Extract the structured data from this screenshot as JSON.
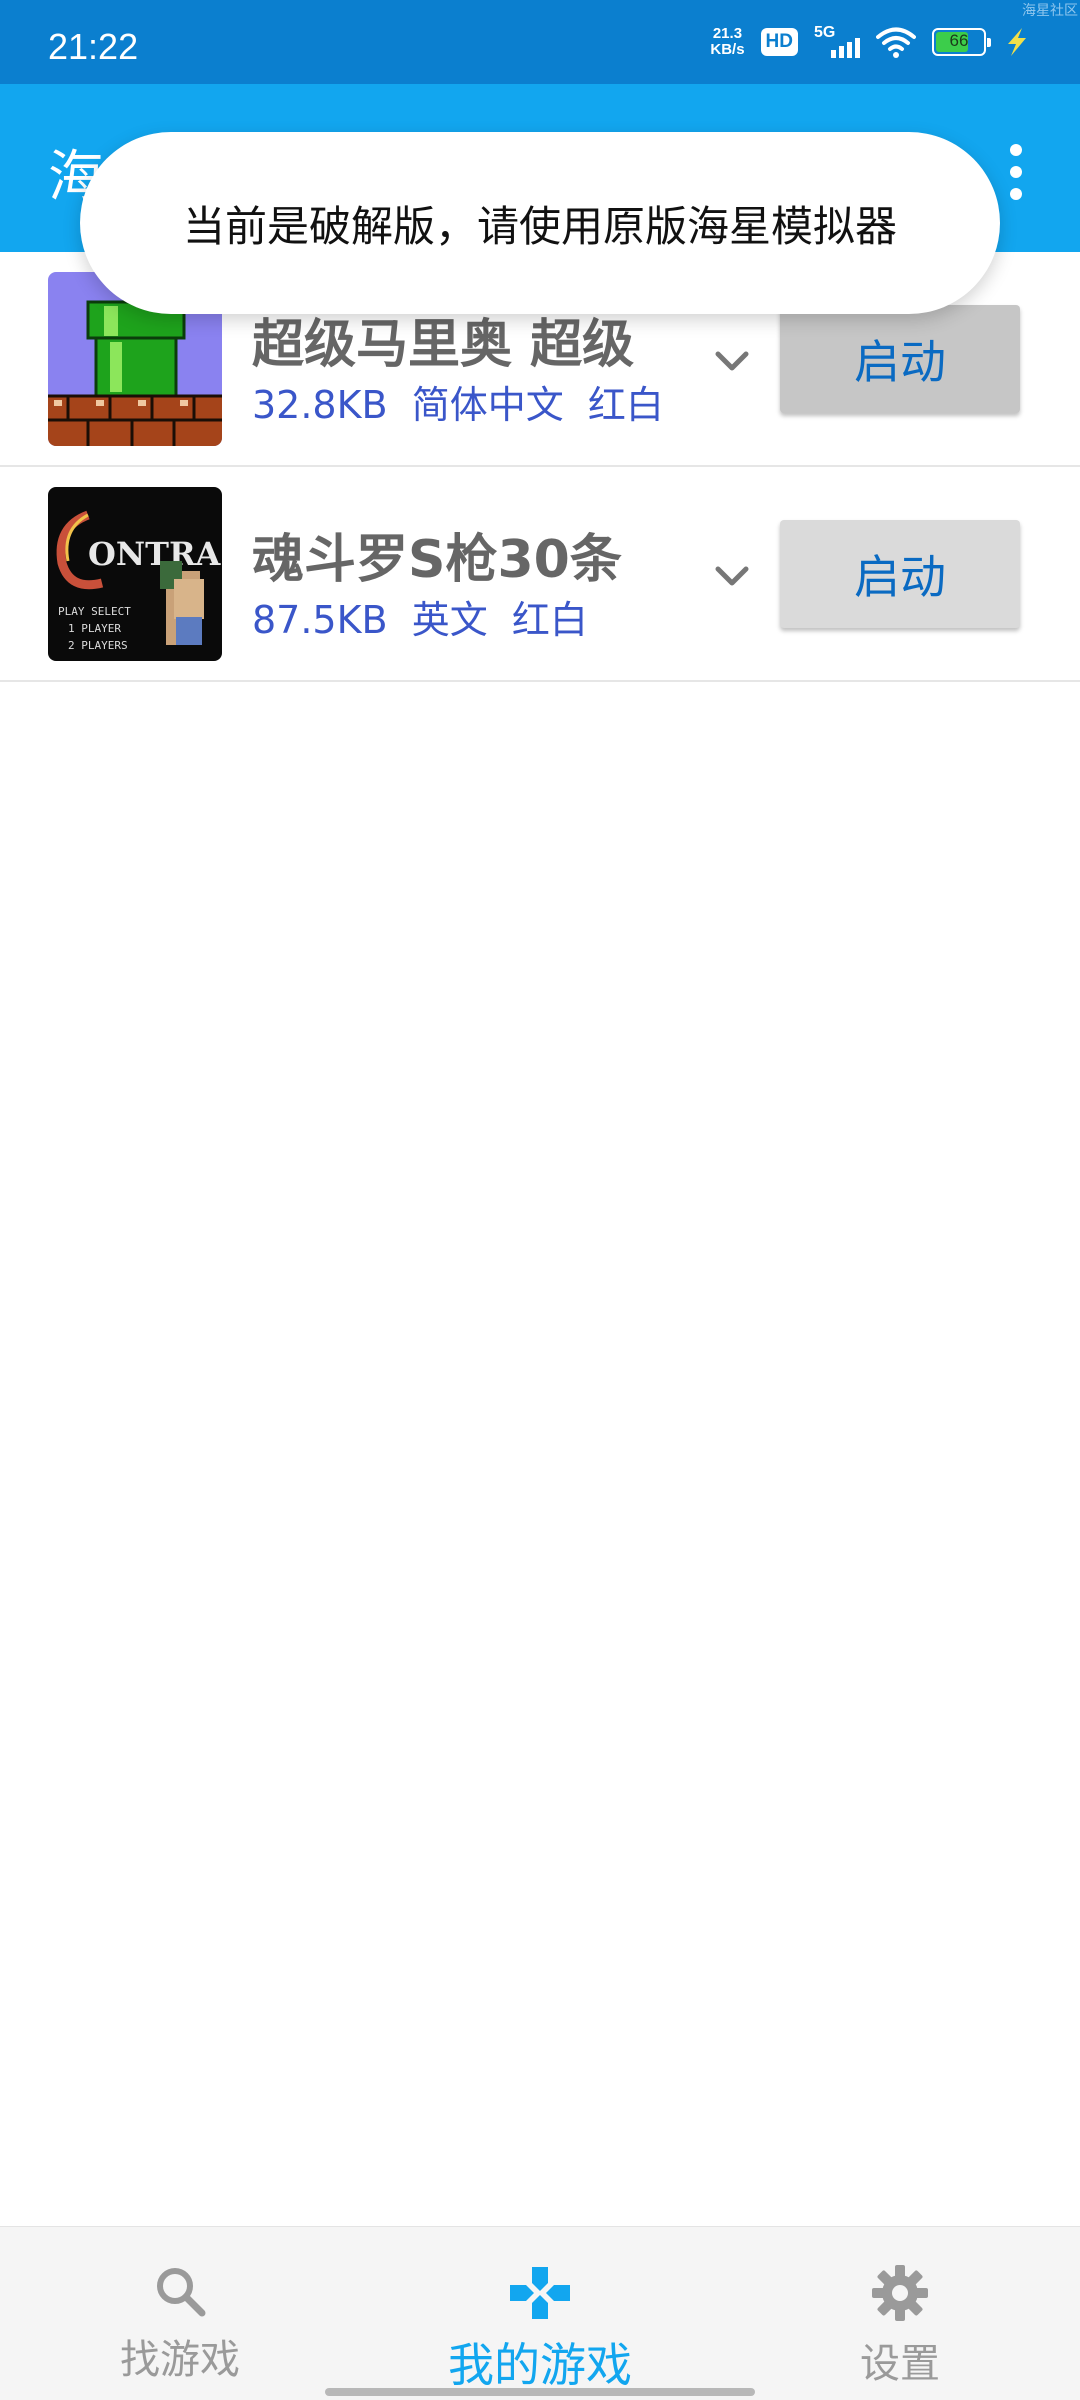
{
  "status_bar": {
    "time": "21:22",
    "net_speed_value": "21.3",
    "net_speed_unit": "KB/s",
    "hd_label": "HD",
    "network_label": "5G",
    "battery_level": "66",
    "watermark": "海星社区"
  },
  "app_bar": {
    "title": "海"
  },
  "toast": {
    "message": "当前是破解版，请使用原版海星模拟器"
  },
  "games": [
    {
      "name": "超级马里奥 超级",
      "size": "32.8KB",
      "language": "简体中文",
      "platform": "红白",
      "launch_label": "启动",
      "thumbnail_icon": "mario-pipe-thumbnail"
    },
    {
      "name": "魂斗罗S枪30条",
      "size": "87.5KB",
      "language": "英文",
      "platform": "红白",
      "launch_label": "启动",
      "thumbnail_icon": "contra-thumbnail"
    }
  ],
  "bottom_nav": {
    "items": [
      {
        "label": "找游戏",
        "icon": "search-icon",
        "active": false
      },
      {
        "label": "我的游戏",
        "icon": "gamepad-icon",
        "active": true
      },
      {
        "label": "设置",
        "icon": "gear-icon",
        "active": false
      }
    ]
  },
  "colors": {
    "status_bar": "#0b7fcf",
    "app_bar": "#12a6ef",
    "accent": "#12a6ef",
    "meta_text": "#3a56c9"
  }
}
